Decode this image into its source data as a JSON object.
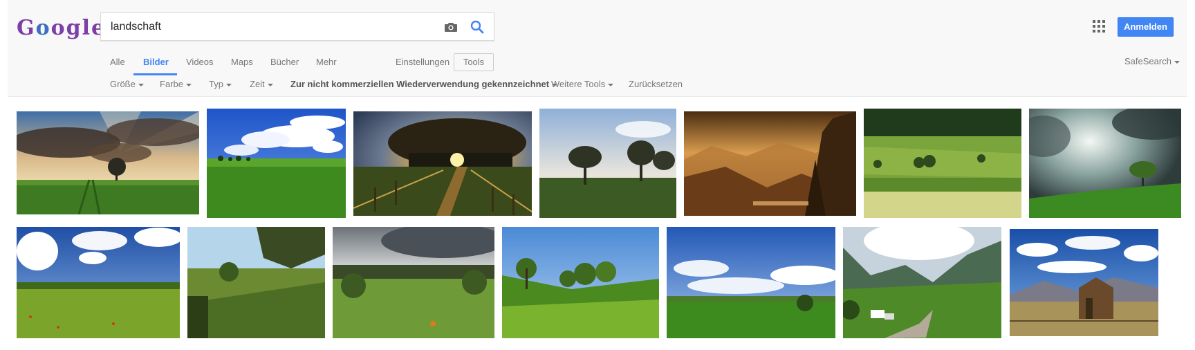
{
  "logo": {
    "text": "Google",
    "letters": [
      "G",
      "o",
      "o",
      "g",
      "l",
      "e"
    ],
    "colors": [
      "#7b3fa6",
      "#3b6fbf",
      "#7b3fa6",
      "#7b3fa6",
      "#7b3fa6",
      "#7b3fa6"
    ]
  },
  "search": {
    "value": "landschaft",
    "camera_icon": "camera-icon",
    "search_icon": "search-icon"
  },
  "header": {
    "apps_icon": "apps-grid-icon",
    "signin_label": "Anmelden"
  },
  "tabs": [
    {
      "label": "Alle",
      "active": false
    },
    {
      "label": "Bilder",
      "active": true
    },
    {
      "label": "Videos",
      "active": false
    },
    {
      "label": "Maps",
      "active": false
    },
    {
      "label": "Bücher",
      "active": false
    },
    {
      "label": "Mehr",
      "active": false
    }
  ],
  "settings_label": "Einstellungen",
  "tools_label": "Tools",
  "safesearch_label": "SafeSearch",
  "filters": [
    {
      "label": "Größe",
      "dropdown": true
    },
    {
      "label": "Farbe",
      "dropdown": true
    },
    {
      "label": "Typ",
      "dropdown": true
    },
    {
      "label": "Zeit",
      "dropdown": true
    },
    {
      "label": "Zur nicht kommerziellen Wiederverwendung gekennzeichnet",
      "dropdown": true
    },
    {
      "label": "Weitere Tools",
      "dropdown": true
    },
    {
      "label": "Zurücksetzen",
      "dropdown": false
    }
  ],
  "results": {
    "row1": [
      {
        "subject": "tree under sun rays and dramatic clouds"
      },
      {
        "subject": "green field with blue sky and white clouds"
      },
      {
        "subject": "sunset behind tree with fenced path"
      },
      {
        "subject": "misty meadow with trees at dawn"
      },
      {
        "subject": "golden mountain valley with fog"
      },
      {
        "subject": "rolling green hills with dark forest"
      },
      {
        "subject": "lone tree under stormy sky"
      }
    ],
    "row2": [
      {
        "subject": "flower meadow with cumulus clouds"
      },
      {
        "subject": "sunny field framed by tree branches"
      },
      {
        "subject": "green pasture under grey clouds"
      },
      {
        "subject": "bright green hills with trees"
      },
      {
        "subject": "wide meadow with blue sky"
      },
      {
        "subject": "alpine valley with village"
      },
      {
        "subject": "old barn under blue sky with clouds"
      }
    ]
  }
}
